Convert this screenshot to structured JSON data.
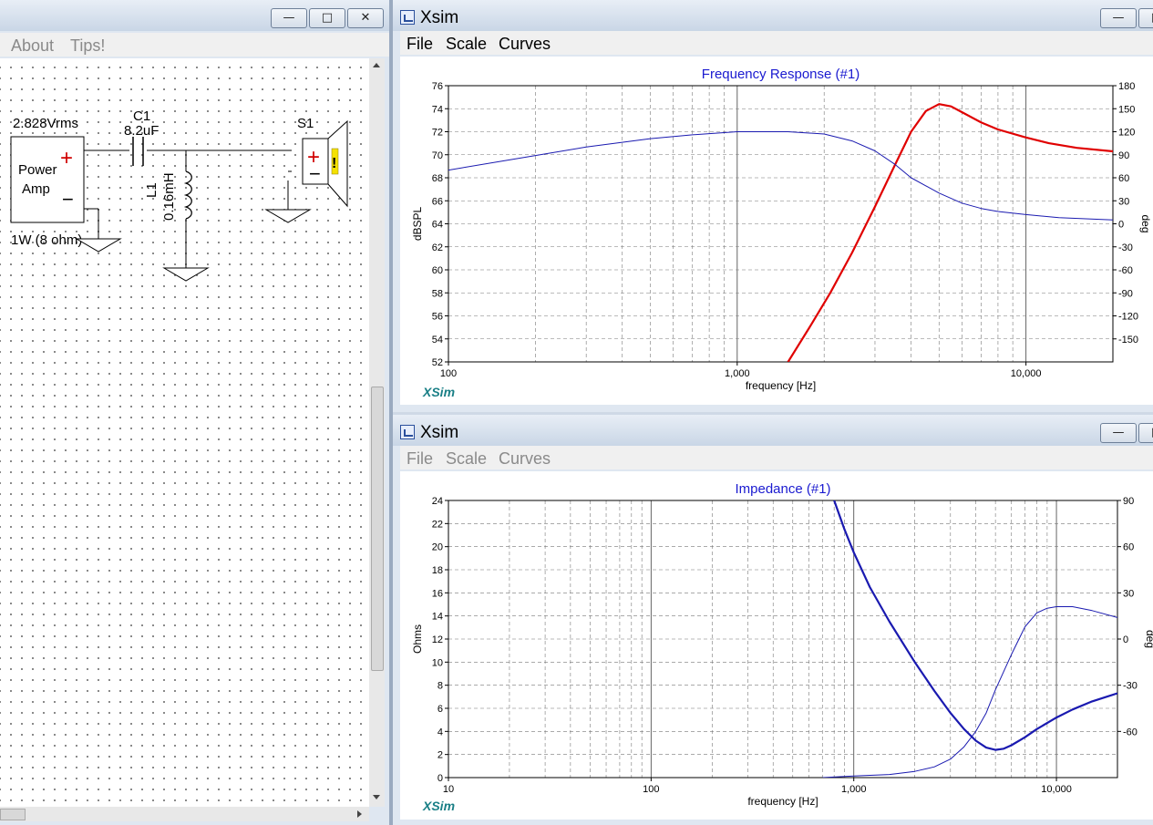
{
  "left_window": {
    "menu": [
      "About",
      "Tips!"
    ],
    "schematic": {
      "source_voltage": "2.828Vrms",
      "source_name_1": "Power",
      "source_name_2": "Amp",
      "source_rating": "1W (8 ohm)",
      "c1_label": "C1",
      "c1_value": "8.2uF",
      "l1_label": "L1",
      "l1_value": "0.16mH",
      "speaker_label": "S1",
      "plus": "+",
      "minus": "−",
      "warn": "!"
    }
  },
  "top_window": {
    "title": "Xsim",
    "menu": [
      "File",
      "Scale",
      "Curves"
    ],
    "brand": "XSim"
  },
  "bottom_window": {
    "title": "Xsim",
    "menu": [
      "File",
      "Scale",
      "Curves"
    ],
    "brand": "XSim"
  },
  "chart_data": [
    {
      "type": "line",
      "title": "Frequency Response (#1)",
      "xlabel": "frequency [Hz]",
      "ylabel": "dBSPL",
      "y2label": "deg",
      "x_scale": "log",
      "xlim": [
        100,
        20000
      ],
      "ylim": [
        52,
        76
      ],
      "y2lim": [
        -180,
        180
      ],
      "x_ticks": [
        {
          "v": 100,
          "t": "100"
        },
        {
          "v": 1000,
          "t": "1,000"
        },
        {
          "v": 10000,
          "t": "10,000"
        }
      ],
      "y_ticks": [
        52,
        54,
        56,
        58,
        60,
        62,
        64,
        66,
        68,
        70,
        72,
        74,
        76
      ],
      "y2_ticks": [
        -150,
        -120,
        -90,
        -60,
        -30,
        0,
        30,
        60,
        90,
        120,
        150,
        180
      ],
      "grid": true,
      "series": [
        {
          "axis": "left",
          "color": "#e00000",
          "width": 2.2,
          "points": [
            [
              1500,
              52
            ],
            [
              1800,
              55.2
            ],
            [
              2100,
              58
            ],
            [
              2500,
              61.5
            ],
            [
              3000,
              65.5
            ],
            [
              3500,
              69
            ],
            [
              4000,
              72
            ],
            [
              4500,
              73.8
            ],
            [
              5000,
              74.4
            ],
            [
              5500,
              74.2
            ],
            [
              6000,
              73.7
            ],
            [
              7000,
              72.8
            ],
            [
              8000,
              72.2
            ],
            [
              10000,
              71.5
            ],
            [
              12000,
              71
            ],
            [
              15000,
              70.6
            ],
            [
              20000,
              70.3
            ]
          ]
        },
        {
          "axis": "right",
          "color": "#1a1ab0",
          "width": 1,
          "points": [
            [
              100,
              70
            ],
            [
              200,
              89
            ],
            [
              300,
              100
            ],
            [
              500,
              111
            ],
            [
              700,
              116
            ],
            [
              1000,
              120
            ],
            [
              1500,
              120
            ],
            [
              2000,
              117
            ],
            [
              2500,
              108
            ],
            [
              3000,
              95
            ],
            [
              3500,
              78
            ],
            [
              4000,
              60
            ],
            [
              5000,
              40
            ],
            [
              6000,
              27
            ],
            [
              7000,
              20
            ],
            [
              8000,
              16
            ],
            [
              10000,
              12
            ],
            [
              13000,
              8
            ],
            [
              20000,
              5
            ]
          ]
        }
      ]
    },
    {
      "type": "line",
      "title": "Impedance (#1)",
      "xlabel": "frequency [Hz]",
      "ylabel": "Ohms",
      "y2label": "deg",
      "x_scale": "log",
      "xlim": [
        10,
        20000
      ],
      "ylim": [
        0,
        24
      ],
      "y2lim": [
        -90,
        90
      ],
      "x_ticks": [
        {
          "v": 10,
          "t": "10"
        },
        {
          "v": 100,
          "t": "100"
        },
        {
          "v": 1000,
          "t": "1,000"
        },
        {
          "v": 10000,
          "t": "10,000"
        }
      ],
      "y_ticks": [
        0,
        2,
        4,
        6,
        8,
        10,
        12,
        14,
        16,
        18,
        20,
        22,
        24
      ],
      "y2_ticks": [
        -60,
        -30,
        0,
        30,
        60,
        90
      ],
      "grid": true,
      "series": [
        {
          "axis": "left",
          "color": "#1a1ab0",
          "width": 2.2,
          "points": [
            [
              800,
              24
            ],
            [
              900,
              21.5
            ],
            [
              1000,
              19.5
            ],
            [
              1200,
              16.5
            ],
            [
              1500,
              13.5
            ],
            [
              2000,
              10
            ],
            [
              2500,
              7.5
            ],
            [
              3000,
              5.6
            ],
            [
              3500,
              4.2
            ],
            [
              4000,
              3.2
            ],
            [
              4500,
              2.6
            ],
            [
              5000,
              2.4
            ],
            [
              5500,
              2.5
            ],
            [
              6000,
              2.8
            ],
            [
              7000,
              3.5
            ],
            [
              8000,
              4.2
            ],
            [
              10000,
              5.2
            ],
            [
              12000,
              5.9
            ],
            [
              15000,
              6.6
            ],
            [
              20000,
              7.3
            ]
          ]
        },
        {
          "axis": "right",
          "color": "#1a1ab0",
          "width": 1,
          "points": [
            [
              700,
              -90
            ],
            [
              1000,
              -89
            ],
            [
              1500,
              -88
            ],
            [
              2000,
              -86
            ],
            [
              2500,
              -83
            ],
            [
              3000,
              -78
            ],
            [
              3500,
              -70
            ],
            [
              4000,
              -60
            ],
            [
              4500,
              -48
            ],
            [
              5000,
              -33
            ],
            [
              6000,
              -10
            ],
            [
              7000,
              8
            ],
            [
              8000,
              17
            ],
            [
              9000,
              20
            ],
            [
              10000,
              21
            ],
            [
              12000,
              21
            ],
            [
              15000,
              18.5
            ],
            [
              20000,
              14
            ]
          ]
        }
      ]
    }
  ]
}
